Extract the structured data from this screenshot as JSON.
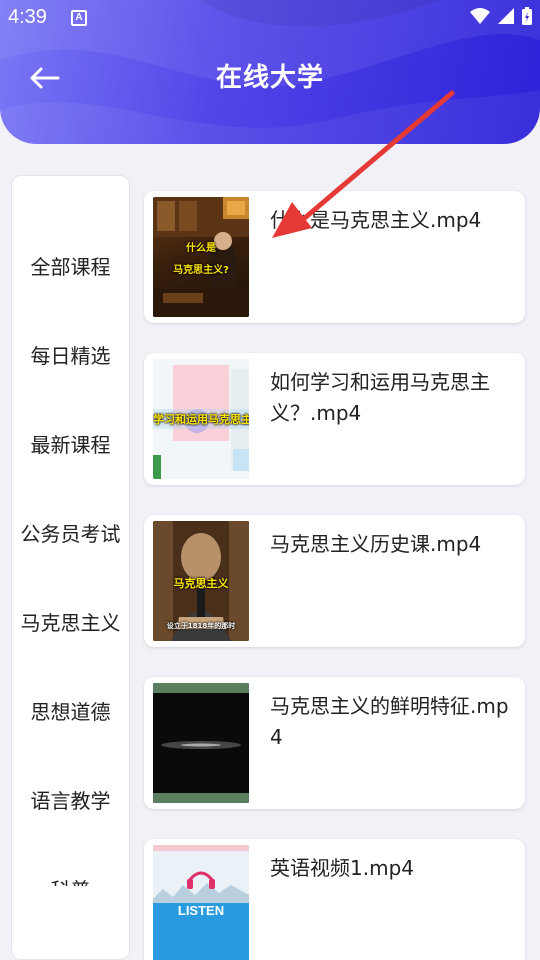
{
  "status_bar": {
    "time": "4:39",
    "notification_icon_label": "A"
  },
  "header": {
    "title": "在线大学",
    "back_icon": "arrow-left-icon"
  },
  "sidebar": {
    "items": [
      {
        "label": "全部课程"
      },
      {
        "label": "每日精选"
      },
      {
        "label": "最新课程"
      },
      {
        "label": "公务员考试"
      },
      {
        "label": "马克思主义"
      },
      {
        "label": "思想道德"
      },
      {
        "label": "语言教学"
      },
      {
        "label": "科普"
      }
    ]
  },
  "videos": [
    {
      "title": "什么是马克思主义.mp4",
      "thumb_caption_1": "什么是",
      "thumb_caption_2": "马克思主义?"
    },
    {
      "title": "如何学习和运用马克思主义？.mp4",
      "thumb_caption_1": "学习和运用马克思主"
    },
    {
      "title": "马克思主义历史课.mp4",
      "thumb_caption_1": "马克思主义",
      "thumb_caption_2": "设立于1818年的那时"
    },
    {
      "title": "马克思主义的鲜明特征.mp4"
    },
    {
      "title": "英语视频1.mp4",
      "thumb_caption_1": "LISTEN"
    }
  ],
  "colors": {
    "header_start": "#7b78f5",
    "header_end": "#2d22d8",
    "background": "#f1f1f7",
    "annotation_arrow": "#e53935"
  }
}
